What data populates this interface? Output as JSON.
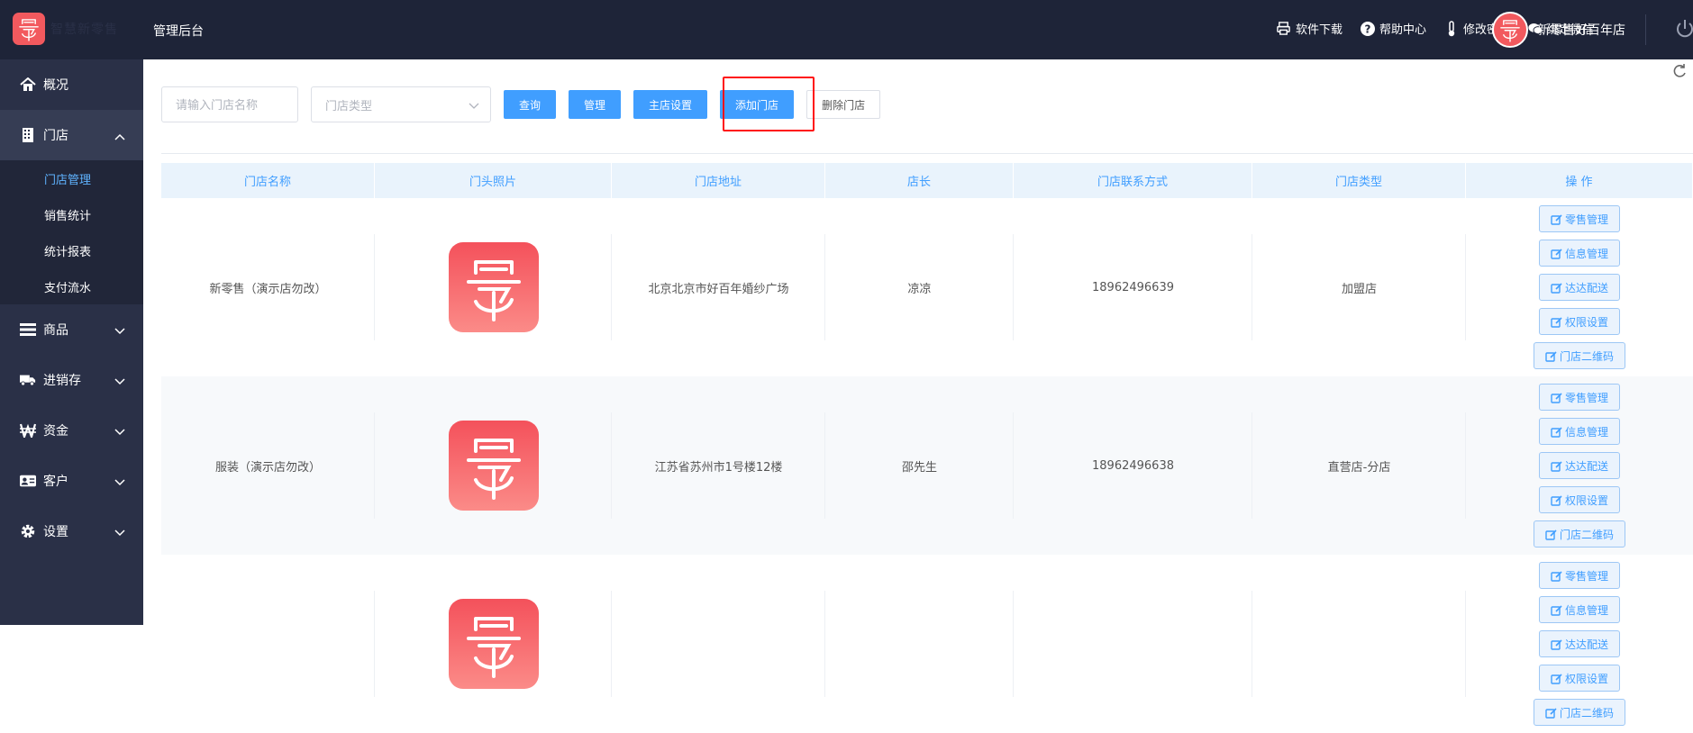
{
  "brand": {
    "logo_text": "智慧新零售"
  },
  "header": {
    "app_title": "管理后台",
    "actions": [
      {
        "label": "软件下载",
        "icon": "printer-icon"
      },
      {
        "label": "帮助中心",
        "icon": "help-icon"
      },
      {
        "label": "修改密码",
        "icon": "thermometer-icon"
      },
      {
        "label": "绑定微信",
        "icon": "wechat-icon"
      }
    ],
    "user_name": "新零售好百年店"
  },
  "sidebar": {
    "items": [
      {
        "label": "概况",
        "icon": "home-icon"
      },
      {
        "label": "门店",
        "icon": "building-icon",
        "expanded": true,
        "children": [
          {
            "label": "门店管理",
            "current": true
          },
          {
            "label": "销售统计"
          },
          {
            "label": "统计报表"
          },
          {
            "label": "支付流水"
          }
        ]
      },
      {
        "label": "商品",
        "icon": "list-icon"
      },
      {
        "label": "进销存",
        "icon": "truck-icon"
      },
      {
        "label": "资金",
        "icon": "won-icon"
      },
      {
        "label": "客户",
        "icon": "id-card-icon"
      },
      {
        "label": "设置",
        "icon": "gear-icon"
      }
    ]
  },
  "toolbar": {
    "search_placeholder": "请输入门店名称",
    "type_placeholder": "门店类型",
    "query": "查询",
    "manage": "管理",
    "main_store": "主店设置",
    "add_store": "添加门店",
    "delete_store": "删除门店"
  },
  "table": {
    "headers": [
      "门店名称",
      "门头照片",
      "门店地址",
      "店长",
      "门店联系方式",
      "门店类型",
      "操 作"
    ],
    "rows": [
      {
        "name": "新零售（演示店勿改）",
        "address": "北京北京市好百年婚纱广场",
        "manager": "凉凉",
        "phone": "18962496639",
        "type": "加盟店"
      },
      {
        "name": "服装（演示店勿改）",
        "address": "江苏省苏州市1号楼12楼",
        "manager": "邵先生",
        "phone": "18962496638",
        "type": "直营店-分店"
      },
      {
        "name": "",
        "address": "",
        "manager": "",
        "phone": "",
        "type": ""
      }
    ],
    "ops": [
      "零售管理",
      "信息管理",
      "达达配送",
      "权限设置",
      "门店二维码"
    ]
  },
  "colors": {
    "topbar": "#1e2438",
    "sidebar": "#2a3047",
    "primary": "#409eff",
    "highlight": "#ff1111",
    "brand": "#f2595e"
  }
}
